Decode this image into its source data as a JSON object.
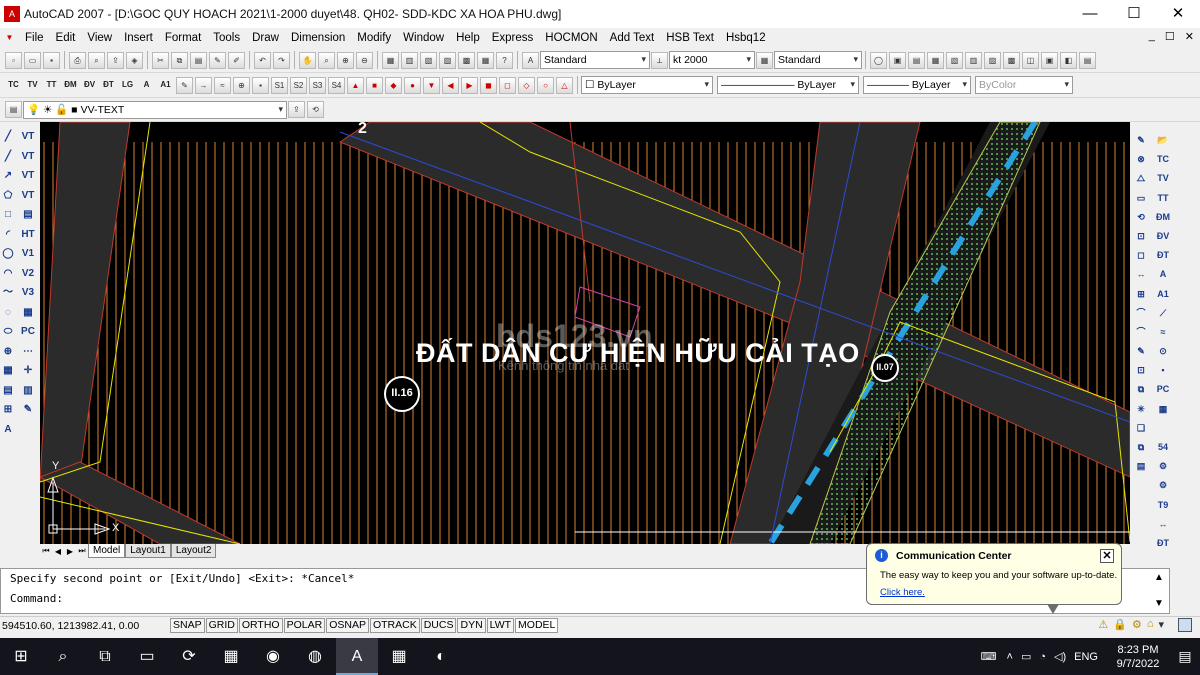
{
  "window": {
    "app_icon": "A",
    "title": "AutoCAD 2007 - [D:\\GOC QUY HOACH 2021\\1-2000 duyet\\48. QH02- SDD-KDC XA HOA PHU.dwg]",
    "minimize": "—",
    "maximize": "☐",
    "close": "✕"
  },
  "menu": {
    "items": [
      "File",
      "Edit",
      "View",
      "Insert",
      "Format",
      "Tools",
      "Draw",
      "Dimension",
      "Modify",
      "Window",
      "Help",
      "Express",
      "HOCMON",
      "Add Text",
      "HSB Text",
      "Hsbq12"
    ],
    "mdi_buttons": [
      "_",
      "☐",
      "✕"
    ]
  },
  "toolbar": {
    "text_style": "Standard",
    "dim_style": "kt 2000",
    "table_style": "Standard",
    "layer": "VV-TEXT",
    "color": "ByLayer",
    "linetype": "ByLayer",
    "lineweight": "ByLayer",
    "plotstyle": "ByColor",
    "text_tools": [
      "TC",
      "TV",
      "TT",
      "ĐM",
      "ĐV",
      "ĐT",
      "LG",
      "A",
      "A1"
    ]
  },
  "left_toolbar": {
    "col1": [
      "╱",
      "╱",
      "↗",
      "⬠",
      "□",
      "◜",
      "◯",
      "◠",
      "〜",
      "◌",
      "⬭",
      "⊕",
      "▦",
      "▤",
      "⊞",
      "A"
    ],
    "col2": [
      "VT",
      "VT",
      "VT",
      "VT",
      "▤",
      "HT",
      "V1",
      "V2",
      "V3",
      "▦",
      "PC",
      "⋯",
      "✛",
      "▥",
      "✎"
    ]
  },
  "right_toolbar": {
    "col1": [
      "✎",
      "⊗",
      "⧍",
      "▭",
      "⟲",
      "⊡",
      "◻",
      "↔",
      "⊞",
      "⌒",
      "⌒",
      "✎",
      "⊡",
      "⧉",
      "✳",
      "❏",
      "⧉",
      "▤"
    ],
    "col2": [
      "📂",
      "TC",
      "TV",
      "TT",
      "ĐM",
      "ĐV",
      "ĐT",
      "A",
      "A1",
      "⟋",
      "≈",
      "⊙",
      "▪",
      "PC",
      "▦",
      "",
      "54",
      "⚙",
      "⚙",
      "T9",
      "↔",
      "ĐT"
    ]
  },
  "drawing": {
    "label_main": "ĐẤT DÂN CƯ HIỆN HỮU CẢI TẠO",
    "watermark": "bds123.vn",
    "watermark_sub": "Kênh thông tin nhà đất",
    "marker_left": "II.16",
    "marker_right": "II.07",
    "marker_top": "2",
    "ucs_y": "Y",
    "ucs_x": "X"
  },
  "tabs": {
    "nav": [
      "⏮",
      "◀",
      "▶",
      "⏭"
    ],
    "items": [
      "Model",
      "Layout1",
      "Layout2"
    ],
    "active": "Model"
  },
  "command": {
    "history": "Specify second point or [Exit/Undo] <Exit>: *Cancel*",
    "prompt": "Command:"
  },
  "status": {
    "coords": "594510.60, 1213982.41, 0.00",
    "buttons": [
      "SNAP",
      "GRID",
      "ORTHO",
      "POLAR",
      "OSNAP",
      "OTRACK",
      "DUCS",
      "DYN",
      "LWT",
      "MODEL"
    ],
    "tray": [
      "⚠",
      "🔒",
      "⚙",
      "⌂",
      "▾"
    ]
  },
  "notification": {
    "icon": "i",
    "title": "Communication Center",
    "body": "The easy way to keep you and your software up-to-date.",
    "link": "Click here.",
    "close": "✕"
  },
  "taskbar": {
    "start_icon": "⊞",
    "apps": [
      "⌕",
      "⧉",
      "▭",
      "⟳",
      "▦",
      "◉",
      "◍",
      "A",
      "▦",
      "◐"
    ],
    "lang": "ENG",
    "time": "8:23 PM",
    "date": "9/7/2022",
    "notif": "▤"
  }
}
